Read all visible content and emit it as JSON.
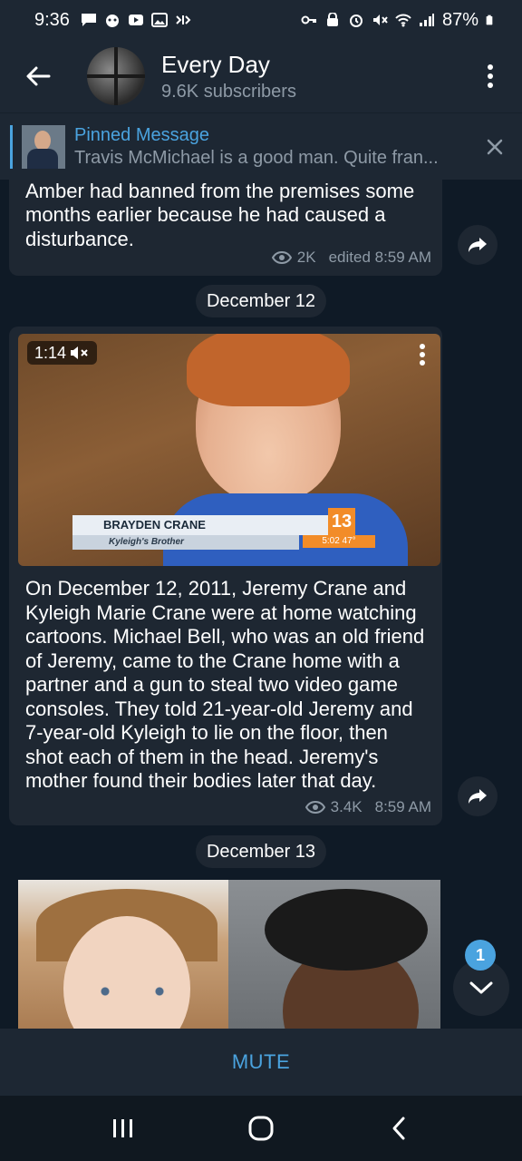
{
  "status_bar": {
    "time": "9:36",
    "battery": "87%"
  },
  "header": {
    "back_label": "Back",
    "title": "Every Day",
    "subscribers": "9.6K subscribers"
  },
  "pinned": {
    "label": "Pinned Message",
    "text": "Travis McMichael is a good man. Quite fran..."
  },
  "messages": [
    {
      "text": "handgun shots by Ronald Seay, whom Amber had banned from the premises some months earlier because he had caused a disturbance.",
      "views": "2K",
      "time": "edited 8:59 AM"
    },
    {
      "text": "On December 12, 2011, Jeremy Crane and Kyleigh Marie Crane were at home watching cartoons. Michael Bell, who was an old friend of Jeremy, came to the Crane home with a partner and a gun to steal two video game consoles. They told 21-year-old Jeremy and 7-year-old Kyleigh to lie on the floor, then shot each of them in the head. Jeremy's mother found their bodies later that day.",
      "views": "3.4K",
      "time": "8:59 AM"
    }
  ],
  "dates": {
    "first": "December 12",
    "second": "December 13"
  },
  "video": {
    "duration": "1:14",
    "lower_third_name": "BRAYDEN CRANE",
    "lower_third_sub": "Kyleigh's Brother",
    "station_logo": "13",
    "station_time": "5:02   47°"
  },
  "unread_count": "1",
  "footer": {
    "mute_label": "MUTE"
  },
  "colors": {
    "accent": "#4aa3df",
    "background": "#0f1a26",
    "bubble": "#1e2732",
    "bar": "#1d2733"
  }
}
